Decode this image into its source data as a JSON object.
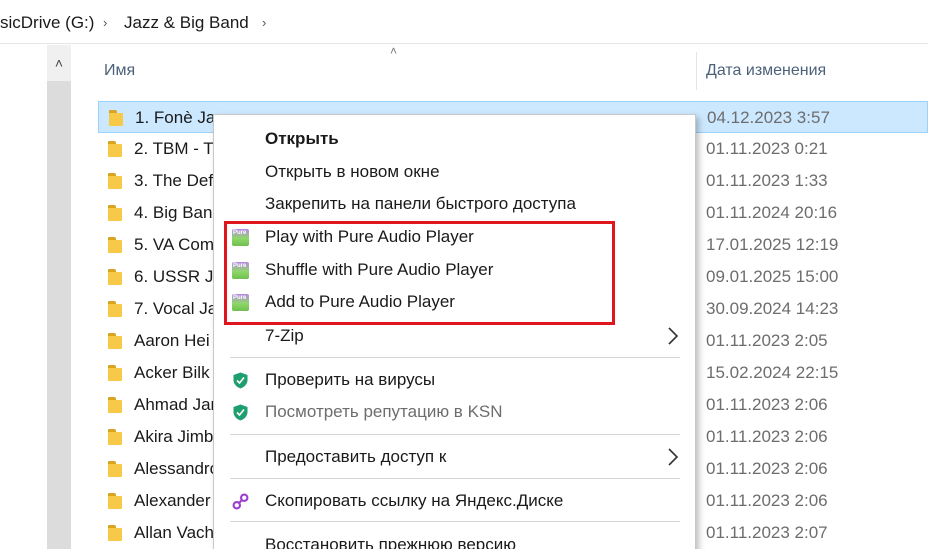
{
  "breadcrumb": {
    "drive": "sicDrive (G:)",
    "folder": "Jazz & Big Band"
  },
  "columns": {
    "name": "Имя",
    "date": "Дата изменения"
  },
  "rows": [
    {
      "name": "1. Fonè Jaz",
      "date": "04.12.2023 3:57",
      "selected": true
    },
    {
      "name": "2. TBM - T",
      "date": "01.11.2023 0:21"
    },
    {
      "name": "3. The Def",
      "date": "01.11.2023 1:33"
    },
    {
      "name": "4. Big Banc",
      "date": "01.11.2024 20:16"
    },
    {
      "name": "5. VA Com",
      "date": "17.01.2025 12:19"
    },
    {
      "name": "6. USSR Ja",
      "date": "09.01.2025 15:00"
    },
    {
      "name": "7. Vocal Ja",
      "date": "30.09.2024 14:23"
    },
    {
      "name": "Aaron Hei",
      "date": "01.11.2023 2:05"
    },
    {
      "name": "Acker Bilk",
      "date": "15.02.2024 22:15"
    },
    {
      "name": "Ahmad Jar",
      "date": "01.11.2023 2:06"
    },
    {
      "name": "Akira Jimb",
      "date": "01.11.2023 2:06"
    },
    {
      "name": "Alessandro",
      "date": "01.11.2023 2:06"
    },
    {
      "name": "Alexander",
      "date": "01.11.2023 2:06"
    },
    {
      "name": "Allan Vach",
      "date": "01.11.2023 2:07"
    }
  ],
  "menu": {
    "open": "Открыть",
    "open_new_window": "Открыть в новом окне",
    "pin_quick_access": "Закрепить на панели быстрого доступа",
    "play_pure": "Play with Pure Audio Player",
    "shuffle_pure": "Shuffle with Pure Audio Player",
    "add_pure": "Add to Pure Audio Player",
    "seven_zip": "7-Zip",
    "scan_virus": "Проверить на вирусы",
    "ksn_reputation": "Посмотреть репутацию в KSN",
    "give_access": "Предоставить доступ к",
    "copy_yandex_link": "Скопировать ссылку на Яндекс.Диске",
    "restore_previous": "Восстановить прежнюю версию"
  },
  "icons": {
    "pure_icon_text": "Pure",
    "shield_color": "#1f9e6e",
    "link_color": "#9b3fd1",
    "highlight_color": "#e0151d"
  }
}
